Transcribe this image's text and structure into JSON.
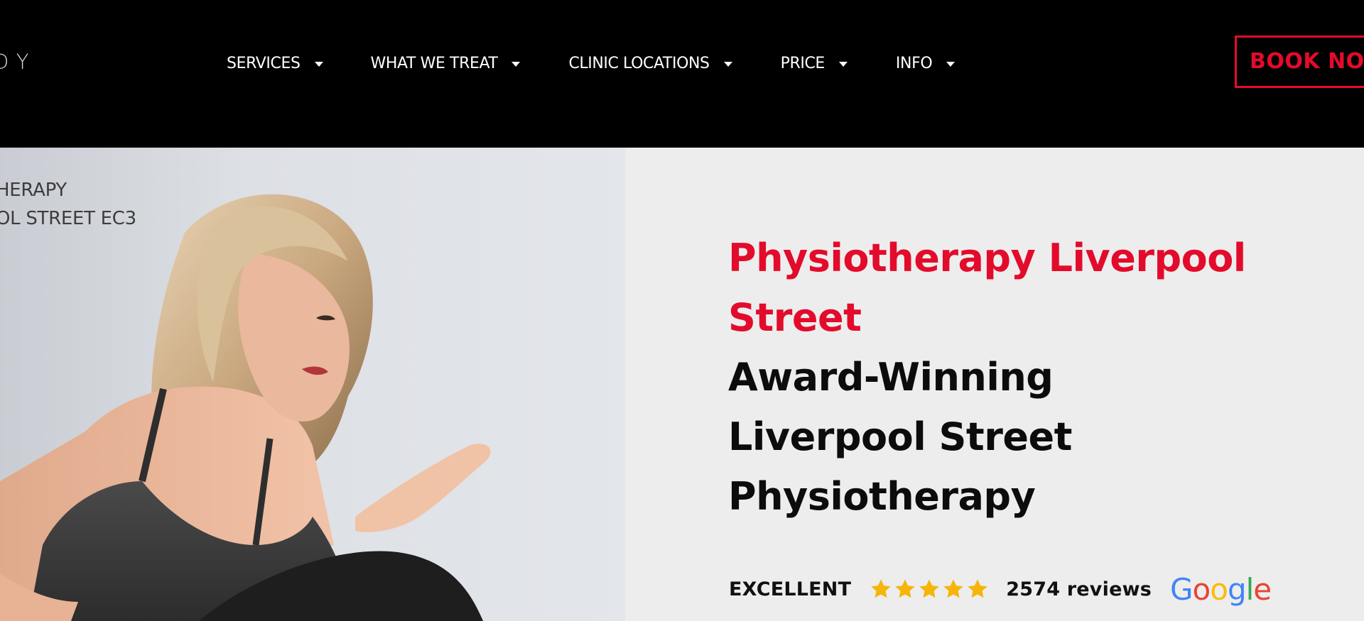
{
  "header": {
    "logo_text": "DY",
    "nav": [
      {
        "label": "SERVICES"
      },
      {
        "label": "WHAT WE TREAT"
      },
      {
        "label": "CLINIC LOCATIONS"
      },
      {
        "label": "PRICE"
      },
      {
        "label": "INFO"
      }
    ],
    "book_button": "BOOK NO"
  },
  "hero": {
    "image_caption": [
      "HERAPY",
      "OL STREET EC3"
    ],
    "title_red": [
      "Physiotherapy Liverpool",
      "Street"
    ],
    "title_black": [
      "Award-Winning",
      "Liverpool Street",
      "Physiotherapy"
    ],
    "rating": {
      "label": "EXCELLENT",
      "stars": 5,
      "reviews": "2574 reviews",
      "brand_icon": "google-logo"
    }
  },
  "colors": {
    "accent": "#e30b2b",
    "header_bg": "#000000",
    "content_bg": "#ededed",
    "star": "#f5b50a"
  }
}
